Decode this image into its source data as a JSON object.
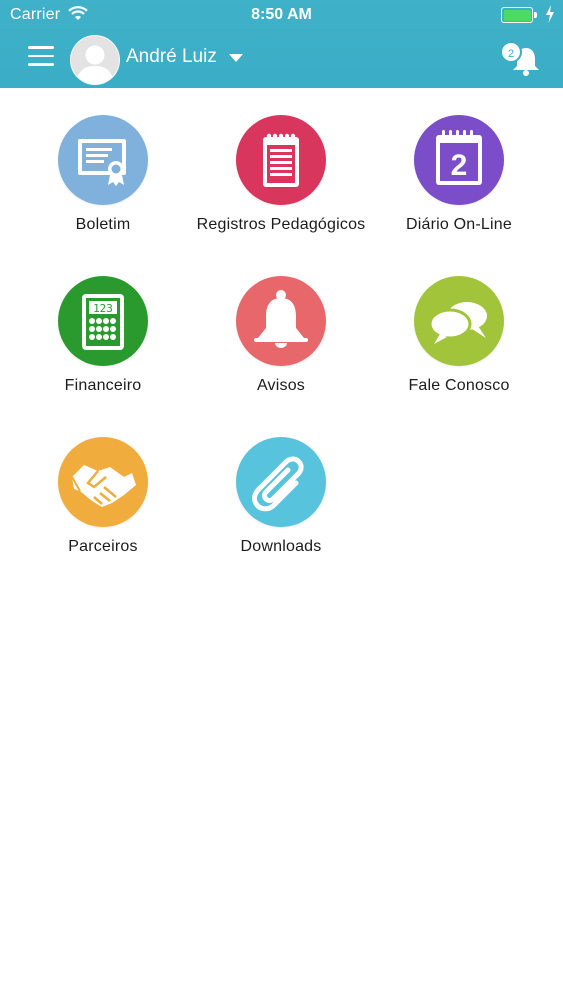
{
  "status_bar": {
    "carrier": "Carrier",
    "time": "8:50 AM"
  },
  "header": {
    "user_name": "André Luiz",
    "notification_count": "2",
    "accent": "#3aaec6"
  },
  "tiles": [
    {
      "label": "Boletim",
      "icon": "certificate-icon",
      "color": "#7fb1dc"
    },
    {
      "label": "Registros Pedagógicos",
      "icon": "notepad-icon",
      "color": "#d8365d"
    },
    {
      "label": "Diário On-Line",
      "icon": "calendar-icon",
      "color": "#7b4dc9"
    },
    {
      "label": "Financeiro",
      "icon": "calculator-icon",
      "color": "#2a9a2f"
    },
    {
      "label": "Avisos",
      "icon": "bell-icon",
      "color": "#e8676b"
    },
    {
      "label": "Fale Conosco",
      "icon": "chat-bubbles-icon",
      "color": "#a2c43a"
    },
    {
      "label": "Parceiros",
      "icon": "handshake-icon",
      "color": "#f0ac3c"
    },
    {
      "label": "Downloads",
      "icon": "paperclip-icon",
      "color": "#58c3dc"
    }
  ],
  "calendar_day": "2",
  "calculator_display": "123"
}
